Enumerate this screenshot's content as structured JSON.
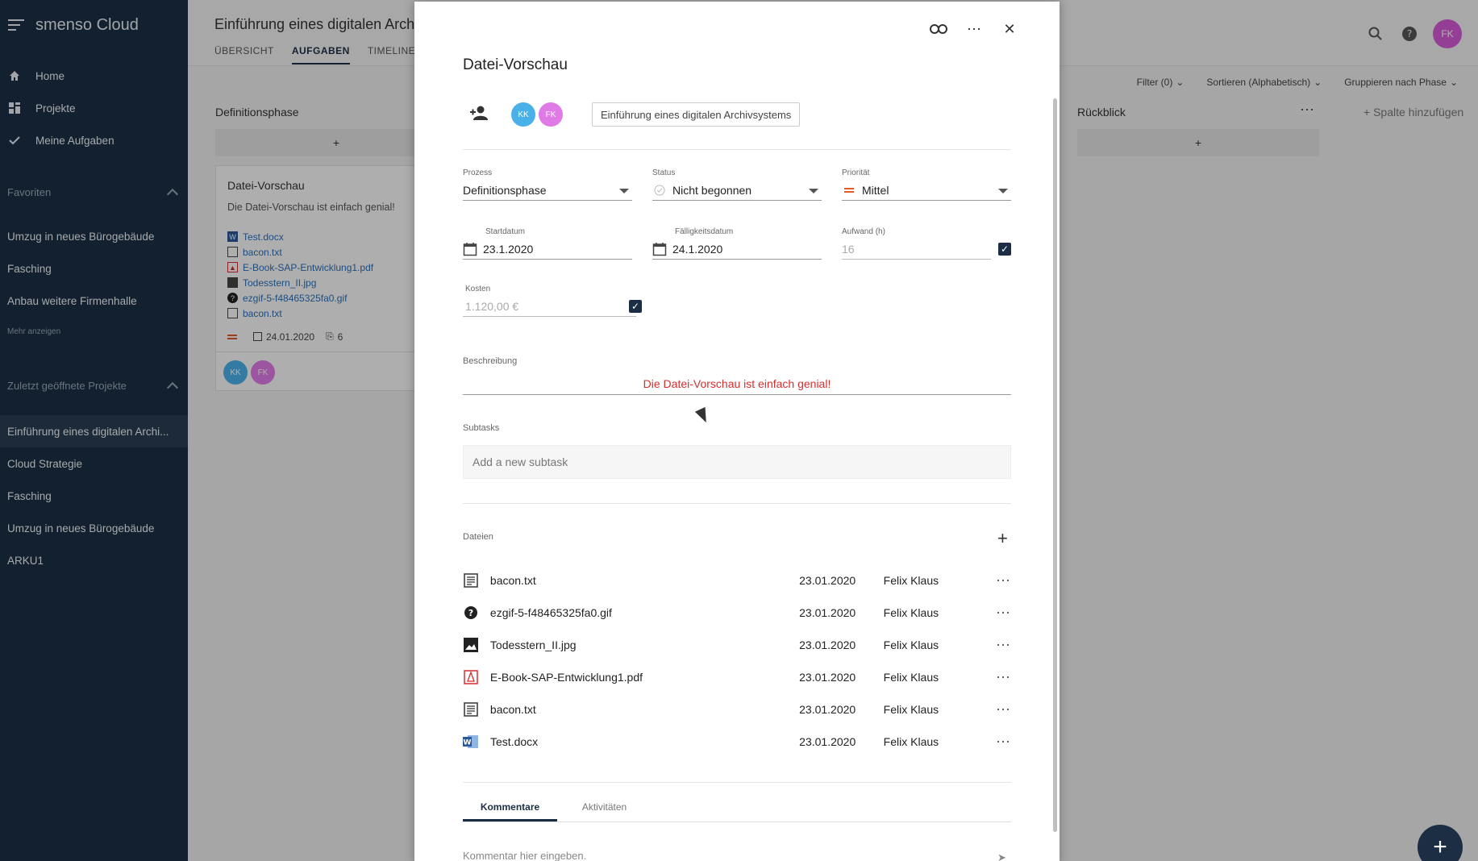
{
  "app": {
    "brand": "smenso Cloud"
  },
  "sidebar": {
    "nav": [
      {
        "label": "Home",
        "icon": "home-icon"
      },
      {
        "label": "Projekte",
        "icon": "grid-icon"
      },
      {
        "label": "Meine Aufgaben",
        "icon": "check-icon"
      }
    ],
    "favorites_title": "Favoriten",
    "favorites": [
      "Umzug in neues Bürogebäude",
      "Fasching",
      "Anbau weitere Firmenhalle"
    ],
    "show_more": "Mehr anzeigen",
    "recent_title": "Zuletzt geöffnete Projekte",
    "recent": [
      "Einführung eines digitalen Archi...",
      "Cloud Strategie",
      "Fasching",
      "Umzug in neues Bürogebäude",
      "ARKU1"
    ]
  },
  "header": {
    "project_title": "Einführung eines digitalen Arch",
    "tabs": [
      "ÜBERSICHT",
      "AUFGABEN",
      "TIMELINE"
    ],
    "user_initials": "FK"
  },
  "toolbar": {
    "filter": "Filter (0)",
    "sort": "Sortieren (Alphabetisch)",
    "group": "Gruppieren nach Phase"
  },
  "board": {
    "col1_title": "Definitionsphase",
    "col2_title": "Rückblick",
    "add_column": "+ Spalte hinzufügen",
    "add": "+",
    "card": {
      "title": "Datei-Vorschau",
      "desc": "Die Datei-Vorschau ist einfach genial!",
      "files": [
        "Test.docx",
        "bacon.txt",
        "E-Book-SAP-Entwicklung1.pdf",
        "Todesstern_II.jpg",
        "ezgif-5-f48465325fa0.gif",
        "bacon.txt"
      ],
      "date": "24.01.2020",
      "attachments": "6",
      "avatars": [
        "KK",
        "FK"
      ]
    }
  },
  "modal": {
    "title": "Datei-Vorschau",
    "avatars": [
      "KK",
      "FK"
    ],
    "project_chip": "Einführung eines digitalen Archivsystems",
    "prozess_label": "Prozess",
    "prozess": "Definitionsphase",
    "status_label": "Status",
    "status": "Nicht begonnen",
    "prio_label": "Priorität",
    "prio": "Mittel",
    "start_label": "Startdatum",
    "start": "23.1.2020",
    "due_label": "Fälligkeitsdatum",
    "due": "24.1.2020",
    "effort_label": "Aufwand (h)",
    "effort": "16",
    "cost_label": "Kosten",
    "cost": "1.120,00 €",
    "desc_label": "Beschreibung",
    "desc": "Die Datei-Vorschau ist einfach genial!",
    "subtasks_label": "Subtasks",
    "subtask_placeholder": "Add a new subtask",
    "files_label": "Dateien",
    "files": [
      {
        "name": "bacon.txt",
        "date": "23.01.2020",
        "user": "Felix Klaus",
        "icon": "text-file-icon"
      },
      {
        "name": "ezgif-5-f48465325fa0.gif",
        "date": "23.01.2020",
        "user": "Felix Klaus",
        "icon": "unknown-file-icon"
      },
      {
        "name": "Todesstern_II.jpg",
        "date": "23.01.2020",
        "user": "Felix Klaus",
        "icon": "image-file-icon"
      },
      {
        "name": "E-Book-SAP-Entwicklung1.pdf",
        "date": "23.01.2020",
        "user": "Felix Klaus",
        "icon": "pdf-file-icon"
      },
      {
        "name": "bacon.txt",
        "date": "23.01.2020",
        "user": "Felix Klaus",
        "icon": "text-file-icon"
      },
      {
        "name": "Test.docx",
        "date": "23.01.2020",
        "user": "Felix Klaus",
        "icon": "word-file-icon"
      }
    ],
    "tab_comments": "Kommentare",
    "tab_activity": "Aktivitäten",
    "comment_placeholder": "Kommentar hier eingeben."
  },
  "colors": {
    "navy": "#1b2e44",
    "red": "#d32f2f",
    "avatar_kk": "#4ab0e8",
    "avatar_fk": "#e07ae6"
  }
}
